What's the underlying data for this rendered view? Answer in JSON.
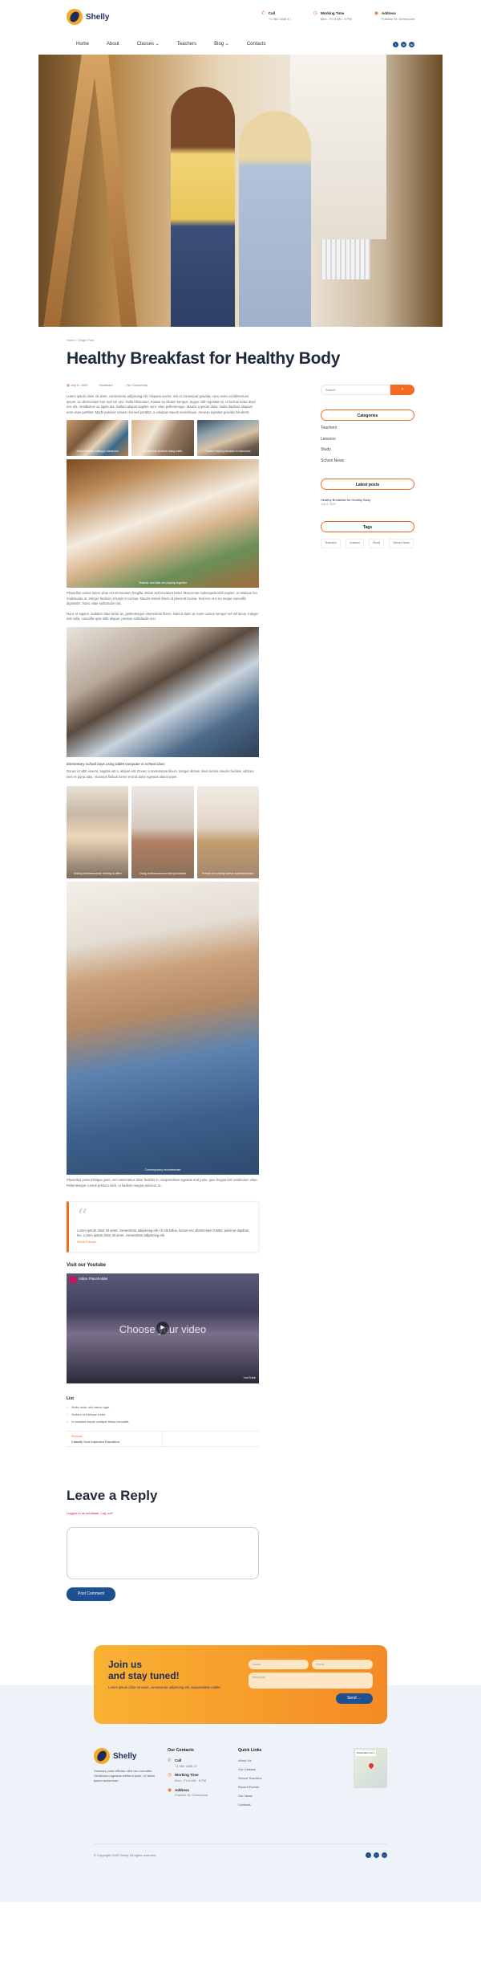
{
  "brand": {
    "name": "Shelly"
  },
  "header": {
    "call": {
      "label": "Call",
      "value": "+1 982 3468 47"
    },
    "hours": {
      "label": "Working Time",
      "value": "Mon - Fri 8 AM - 5 PM"
    },
    "address": {
      "label": "Address",
      "value": "Franklin St, Greenpoint"
    }
  },
  "nav": {
    "items": [
      "Home",
      "About",
      "Classes",
      "Teachers",
      "Blog",
      "Contacts"
    ]
  },
  "socials": [
    "f",
    "in",
    "tw"
  ],
  "breadcrumb": {
    "home": "Home",
    "sep": "/",
    "current": "Single Post"
  },
  "post": {
    "title": "Healthy Breakfast for Healthy Body",
    "date": "July 6, 2020",
    "category": "Hardware",
    "comments": "No Comments",
    "intro": "Lorem ipsum dolor sit amet, consectetur adipiscing elit. Aliquam auctor, nisi et consequat gravida, nunc enim condimentum ipsum, ac ullamcorper nisi erat vel orci. Nulla bibendum, massa eu dictum tempus, augue nibh egestas mi, ut lacinia tortor diam nec elit. Vestibulum ac ligula dui. Nullam aliquet sagittis nunc vitae pellentesque. Mauris a ipsum dolor. Nulla dapibus aliquam eros vitae porttitor. Morbi pulvinar ornare nisl sed porttitor, a volutpat mauris scelerisque. Aenean egestas gravida hendrerit.",
    "gallery1": [
      "School teacher smiling in classroom",
      "Elementary students doing crafts",
      "Teacher helping students in classroom"
    ],
    "img1_caption": "Teacher and kids are playing together",
    "para2": "Phasellus varius lorem vitae est elementum fringilla. Etiam sed tincidunt tortor. Maecenas malesuada nibh sapien, ut tristique leo malesuada at. Integer facilisis ut turpis id cursus. Mauris ornare libero id placerat lacinia. Sed nec orci eu neque convallis dignissim. Nunc vitae sollicitudin nisi.",
    "para3": "Nunc et sapien, sodales vitae tortor ac, pellentesque elementum libero. Nam a diam ac enim cursus semper vel vel lacus. Integer nisl nulla, convallis quis nibh aliquet, pretium sollicitudin orci.",
    "subhead": "Elementary school boys using tablet computer in school class",
    "para4": "Donec id nibh viverra, sagittis elit a, aliquet elit. Donec a scelerisque libero. Integer dictum risus lacinia mauris facilisis, ultrices sem et porta odio. Vivamus finibus lorem erat id dolor egestas ullamcorper.",
    "gallery2": [
      "Smiling businesswoman working in office",
      "Young businesswoman eating breakfast",
      "Portrait of a smiling woman businesswoman"
    ],
    "img2_caption": "Contemporary businessman",
    "para5": "Phasellus porta tristique justo, vel consectetur dolor facilisis in. Suspendisse egestas erat justo, quis feugiat nisl vestibulum vitae. Pellentesque cursus pretium nibh, ut facilisis magna pulvinar ac.",
    "quote": {
      "text": "Lorem ipsum dolor sit amet, consectetur adipiscing elit. Ut elit tellus, luctus nec ullamcorper mattis, pulvinar dapibus leo. Lorem ipsum dolor sit amet, consectetur adipiscing elit.",
      "author": "Reina Francis"
    },
    "youtube_heading": "Visit our Youtube",
    "video": {
      "title": "Video Placeholder",
      "overlay": "Choose your video",
      "brand": "YouTube"
    },
    "list": {
      "heading": "List",
      "items": [
        "Nulla dolor nisl varius eget",
        "Nullam in tristique tortor",
        "In sodales turpis volutpat tellus convallis"
      ]
    },
    "postnav": {
      "prev_label": "Previous",
      "prev_title": "Classify Your Improved Education"
    }
  },
  "reply": {
    "heading": "Leave a Reply",
    "logged": "Logged in as medialab. Log out?",
    "button": "Post Comment"
  },
  "sidebar": {
    "search_placeholder": "Search",
    "categories_title": "Categories",
    "categories": [
      "Teachers",
      "Lessons",
      "Study",
      "School News"
    ],
    "latest_title": "Latest posts",
    "latest": {
      "title": "Healthy Breakfast for Healthy Body",
      "date": "July 6, 2020"
    },
    "tags_title": "Tags",
    "tags": [
      "Teachers",
      "Lessons",
      "Study",
      "School News"
    ]
  },
  "newsletter": {
    "title_line1": "Join us",
    "title_line2": "and stay tuned!",
    "text": "Lorem ipsum dolor sit amet, consectetur adipiscing elit. Suspendisse mattis.",
    "name_ph": "Name",
    "email_ph": "Email",
    "message_ph": "Message",
    "send": "Send"
  },
  "footer": {
    "about": "Vivamus porta efficitur nibh nec convallis. Vestibulum egestas eleifend justo. Ut tellus ipsum accumsan.",
    "contacts_title": "Our Contacts",
    "links_title": "Quick Links",
    "links": [
      "About Us",
      "Our Classes",
      "School Teachers",
      "Recent Events",
      "Our News",
      "Contacts"
    ],
    "map_label": "Daneoduk Live L",
    "copyright": "© Copyright 2020 Shelly. All rights reserved."
  },
  "colors": {
    "accent": "#f26b21",
    "primary": "#1d4f91",
    "dark": "#1e2a5a"
  }
}
